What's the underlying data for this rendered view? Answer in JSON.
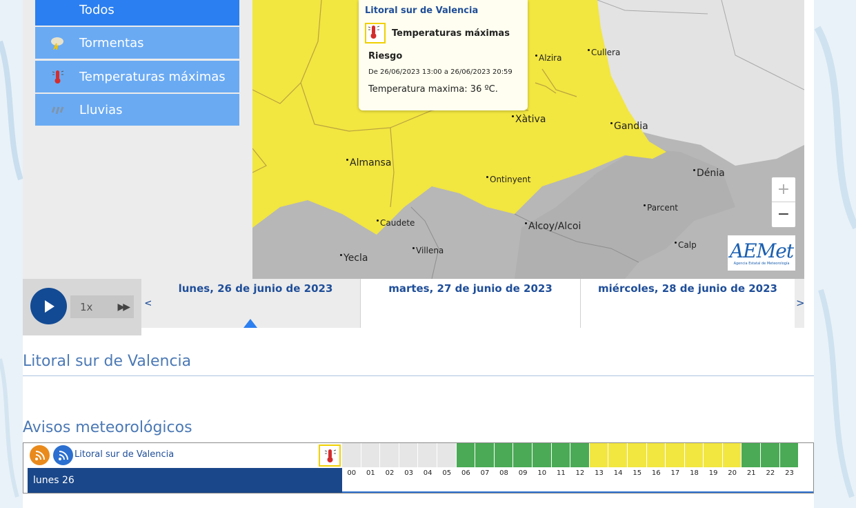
{
  "colors": {
    "menu_active": "#2b7ff0",
    "menu_item": "#6aaaf3",
    "yellow_warning": "#f2e640",
    "green_level": "#4aaa55",
    "gray_none": "#e6e6e6",
    "day_blue": "#1a4789",
    "text_blue": "#1f4e99"
  },
  "menu": {
    "items": [
      {
        "label": "Todos",
        "icon": "all-icon",
        "active": true
      },
      {
        "label": "Tormentas",
        "icon": "storm-icon",
        "active": false
      },
      {
        "label": "Temperaturas máximas",
        "icon": "thermometer-icon",
        "active": false
      },
      {
        "label": "Lluvias",
        "icon": "rain-icon",
        "active": false
      }
    ]
  },
  "map": {
    "cities": [
      {
        "name": "Alzira"
      },
      {
        "name": "Cullera"
      },
      {
        "name": "Xàtiva"
      },
      {
        "name": "Gandia"
      },
      {
        "name": "Almansa"
      },
      {
        "name": "Ontinyent"
      },
      {
        "name": "Dénia"
      },
      {
        "name": "Parcent"
      },
      {
        "name": "Caudete"
      },
      {
        "name": "Alcoy/Alcoi"
      },
      {
        "name": "Calp"
      },
      {
        "name": "Villena"
      },
      {
        "name": "Yecla"
      }
    ],
    "popup": {
      "title": "Litoral sur de Valencia",
      "warning": "Temperaturas máximas",
      "level": "Riesgo",
      "dates": "De 26/06/2023 13:00 a 26/06/2023 20:59",
      "detail": "Temperatura maxima: 36 ºC."
    },
    "zoom_in": "+",
    "zoom_out": "−",
    "logo_text": "AEMet",
    "logo_sub": "Agencia Estatal de Meteorología"
  },
  "player": {
    "speed": "1x",
    "prev": "<",
    "next": ">"
  },
  "days": [
    {
      "label": "lunes, 26 de junio de 2023",
      "active": true
    },
    {
      "label": "martes, 27 de junio de 2023",
      "active": false
    },
    {
      "label": "miércoles, 28 de junio de 2023",
      "active": false
    }
  ],
  "section": {
    "region_title": "Litoral sur de Valencia",
    "avisos_title": "Avisos meteorológicos"
  },
  "warnings_table": {
    "region": "Litoral sur de Valencia",
    "day_label": "lunes 26",
    "hours": [
      "00",
      "01",
      "02",
      "03",
      "04",
      "05",
      "06",
      "07",
      "08",
      "09",
      "10",
      "11",
      "12",
      "13",
      "14",
      "15",
      "16",
      "17",
      "18",
      "19",
      "20",
      "21",
      "22",
      "23"
    ],
    "levels": [
      "none",
      "none",
      "none",
      "none",
      "none",
      "none",
      "green",
      "green",
      "green",
      "green",
      "green",
      "green",
      "green",
      "yellow",
      "yellow",
      "yellow",
      "yellow",
      "yellow",
      "yellow",
      "yellow",
      "yellow",
      "green",
      "green",
      "green"
    ]
  }
}
